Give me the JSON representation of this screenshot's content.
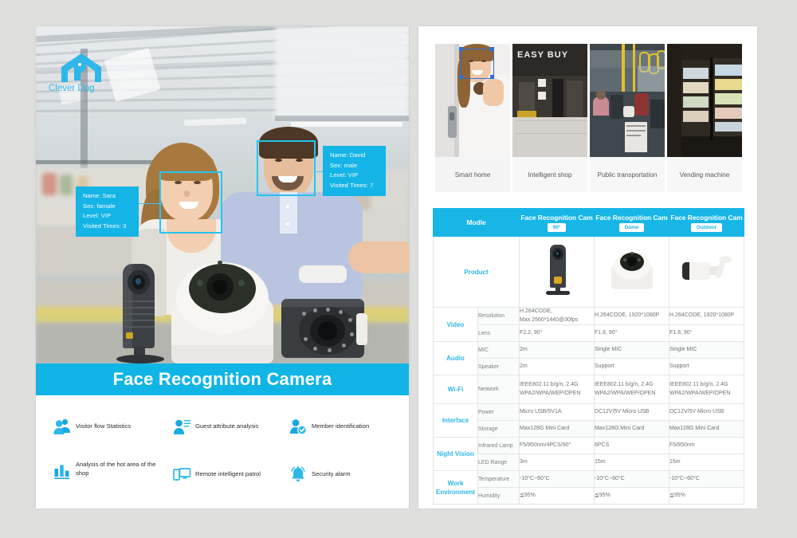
{
  "brand": {
    "logo_name": "house-dog-logo",
    "name": "Clever Dog"
  },
  "left_page": {
    "title": "Face Recognition Camera",
    "detections": [
      {
        "name_label": "Name: Sara",
        "sex_label": "Sex: famale",
        "level_label": "Level: VIP",
        "visits_label": "Visited Times: 3"
      },
      {
        "name_label": "Name: David",
        "sex_label": "Sex: male",
        "level_label": "Level: VIP",
        "visits_label": "Visited Times: 7"
      }
    ],
    "features": [
      {
        "icon": "two-people-icon",
        "label": "Visitor flow Statistics"
      },
      {
        "icon": "person-list-icon",
        "label": "Guest attribute analysis"
      },
      {
        "icon": "person-check-icon",
        "label": "Member identification"
      },
      {
        "icon": "bar-chart-icon",
        "label": "Analysis of the hot area of the shop"
      },
      {
        "icon": "devices-icon",
        "label": "Remote intelligent patrol"
      },
      {
        "icon": "bell-icon",
        "label": "Security alarm"
      }
    ]
  },
  "right_page": {
    "scenes": [
      {
        "caption": "Smart home"
      },
      {
        "caption": "Intelligent shop",
        "sign": "EASY BUY"
      },
      {
        "caption": "Public transportation"
      },
      {
        "caption": "Vending machine"
      }
    ],
    "table": {
      "header": {
        "model_label": "Modle",
        "columns": [
          {
            "title": "Face Recognition Cam",
            "badge": "90°"
          },
          {
            "title": "Face Recognition Cam",
            "badge": "Dome"
          },
          {
            "title": "Face Recognition Cam",
            "badge": "Outdoor"
          }
        ]
      },
      "product_row_label": "Product",
      "products": [
        {
          "type": "box-camera-on-stand"
        },
        {
          "type": "dome-camera"
        },
        {
          "type": "bullet-camera"
        }
      ],
      "groups": [
        {
          "category": "Video",
          "rows": [
            {
              "label": "Resolution",
              "values": [
                "H.264CODE,\nMax 2560*1440@30fps",
                "H.264CODE, 1920*1080P",
                "H.264CODE, 1920*1080P"
              ]
            },
            {
              "label": "Lens",
              "values": [
                "F2.2, 90°",
                "F1.8, 90°",
                "F1.8, 90°"
              ]
            }
          ]
        },
        {
          "category": "Audio",
          "rows": [
            {
              "label": "MIC",
              "values": [
                "2m",
                "Single MIC",
                "Single MIC"
              ]
            },
            {
              "label": "Speaker",
              "values": [
                "2m",
                "Support",
                "Support"
              ]
            }
          ]
        },
        {
          "category": "Wi-Fi",
          "rows": [
            {
              "label": "Network",
              "values": [
                "IEEE802.11 b/g/n, 2.4G\nWPA2/WPA/WEP/OPEN",
                "IEEE802.11 b/g/n, 2.4G\nWPA2/WPA/WEP/OPEN",
                "IEEE802.11 b/g/n, 2.4G\nWPA2/WPA/WEP/OPEN"
              ]
            }
          ]
        },
        {
          "category": "Interface",
          "rows": [
            {
              "label": "Power",
              "values": [
                "Micro USB/5V1A",
                "DC12V/5V Micro USB",
                "DC12V/5V Micro USB"
              ]
            },
            {
              "label": "Storage",
              "values": [
                "Max128G Mini Card",
                "Max128G Mini Card",
                "Max128G Mini Card"
              ]
            }
          ]
        },
        {
          "category": "Night Vision",
          "rows": [
            {
              "label": "Infrared Lamp",
              "values": [
                "F5/850nm/4PCS/90°",
                "6PCS",
                "F5/850nm"
              ]
            },
            {
              "label": "LED Range",
              "values": [
                "3m",
                "15m",
                "15m"
              ]
            }
          ]
        },
        {
          "category": "Work Environment",
          "rows": [
            {
              "label": "Temperature",
              "values": [
                "-10°C~60°C",
                "-10°C~60°C",
                "-10°C~60°C"
              ]
            },
            {
              "label": "Humidity",
              "values": [
                "≦95%",
                "≦95%",
                "≦95%"
              ]
            }
          ]
        }
      ]
    }
  },
  "colors": {
    "accent": "#14b4e6",
    "accent_dark": "#10b5e5",
    "table_header": "#17b6e7",
    "category_text": "#2cb6e8",
    "page_bg": "#dededd"
  }
}
